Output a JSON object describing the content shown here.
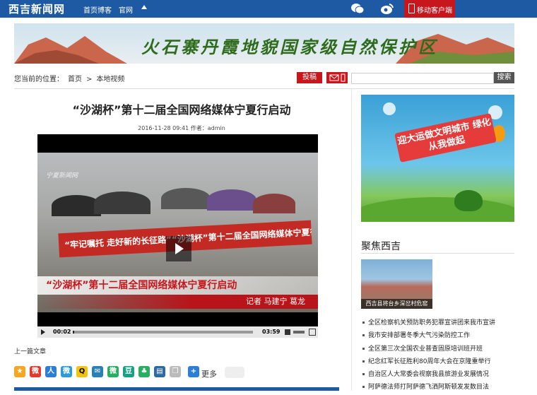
{
  "topbar": {
    "logo": "西吉新闻网",
    "nav": [
      "首页",
      "博客",
      "官网"
    ],
    "mobile_label": "移动客户端"
  },
  "banner": {
    "text": "火石寨丹霞地貌国家级自然保护区"
  },
  "breadcrumb": {
    "prefix": "您当前的位置：",
    "home": "首页",
    "sep": ">",
    "current": "本地视频"
  },
  "toolbar": {
    "tougao": "投稿",
    "search_button": "搜索",
    "search_value": ""
  },
  "article": {
    "title": "“沙湖杯”第十二届全国网络媒体宁夏行启动",
    "meta": "2016-11-28 09:41  作者：admin",
    "prev_label": "上一篇文章",
    "share_more": "更多"
  },
  "video": {
    "logo": "宁夏新闻网",
    "banner_text": "“牢记嘱托 走好新的长征路”“沙湖杯”第十二届全国网络媒体宁夏行",
    "caption": "“沙湖杯”第十二届全国网络媒体宁夏行启动",
    "reporter": "记者  马建宁  葛龙",
    "current_time": "00:02",
    "duration": "03:59",
    "progress": 0.008
  },
  "sidebar": {
    "ad_text": "迎大运做文明城市 绿化从我做起",
    "focus_title": "聚焦西吉",
    "focus_caption": "西吉县将台乡深岔村危窑",
    "news": [
      "全区检察机关预防职务犯罪宣讲团来我市宣讲",
      "我市安排部署冬季大气污染防控工作",
      "全区第三次全国农业普查固原培训班开班",
      "纪念红军长征胜利80周年大会在京隆重举行",
      "自治区人大常委会视察我县旅游业发展情况",
      "阿萨德法师打阿萨德飞洒阿斯顿发发数目法"
    ]
  },
  "colors": {
    "brand_blue": "#1d5aa3",
    "accent_red": "#c8161d"
  }
}
